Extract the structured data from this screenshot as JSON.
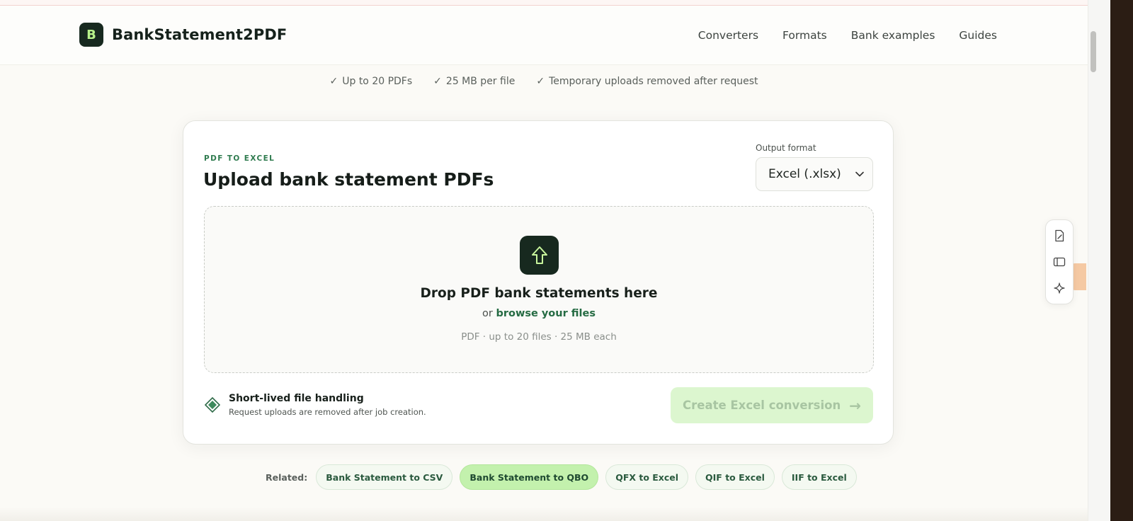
{
  "brand": {
    "mark": "B",
    "name": "BankStatement2PDF",
    "color": "#17291f",
    "accent": "#b7f28a"
  },
  "nav": {
    "items": [
      {
        "label": "Converters"
      },
      {
        "label": "Formats"
      },
      {
        "label": "Bank examples"
      },
      {
        "label": "Guides"
      }
    ]
  },
  "trust": {
    "items": [
      {
        "check": "✓",
        "text": "Up to 20 PDFs"
      },
      {
        "check": "✓",
        "text": "25 MB per file"
      },
      {
        "check": "✓",
        "text": "Temporary uploads removed after request"
      }
    ]
  },
  "card": {
    "eyebrow": "PDF TO EXCEL",
    "title": "Upload bank statement PDFs",
    "output_format_label": "Output format",
    "output_format_value": "Excel (.xlsx)",
    "dropzone": {
      "icon": "upload-arrow-icon",
      "title": "Drop PDF bank statements here",
      "or_text": "or",
      "browse_text": "browse your files",
      "hint": "PDF · up to 20 files · 25 MB each"
    },
    "handling": {
      "icon": "diamond-icon",
      "title": "Short-lived file handling",
      "desc": "Request uploads are removed after job creation."
    },
    "convert_button": {
      "label": "Create Excel conversion",
      "arrow": "→",
      "state": "disabled",
      "color": "#dcf6cf"
    }
  },
  "related": {
    "label": "Related:",
    "chips": [
      {
        "label": "Bank Statement to CSV",
        "active": false
      },
      {
        "label": "Bank Statement to QBO",
        "active": true
      },
      {
        "label": "QFX to Excel",
        "active": false
      },
      {
        "label": "QIF to Excel",
        "active": false
      },
      {
        "label": "IIF to Excel",
        "active": false
      }
    ]
  },
  "side_toolbar": {
    "tools": [
      {
        "icon": "edit-document-icon"
      },
      {
        "icon": "sidebar-panel-icon"
      },
      {
        "icon": "sparkle-icon"
      }
    ]
  }
}
